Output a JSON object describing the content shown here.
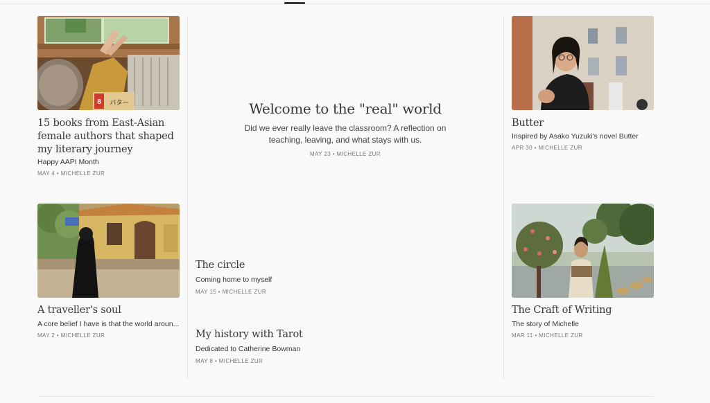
{
  "posts": {
    "left_top": {
      "title": "15 books from East-Asian female authors that shaped my literary journey",
      "subtitle": "Happy AAPI Month",
      "date": "MAY 4",
      "author": "MICHELLE ZUR"
    },
    "left_bottom": {
      "title": "A traveller's soul",
      "subtitle": "A core belief I have is that the world aroun...",
      "date": "MAY 2",
      "author": "MICHELLE ZUR"
    },
    "featured": {
      "title": "Welcome to the \"real\" world",
      "subtitle": "Did we ever really leave the classroom? A reflection on teaching, leaving, and what stays with us.",
      "date": "MAY 23",
      "author": "MICHELLE ZUR"
    },
    "middle_1": {
      "title": "The circle",
      "subtitle": "Coming home to myself",
      "date": "MAY 15",
      "author": "MICHELLE ZUR"
    },
    "middle_2": {
      "title": "My history with Tarot",
      "subtitle": "Dedicated to Catherine Bowman",
      "date": "MAY 8",
      "author": "MICHELLE ZUR"
    },
    "right_top": {
      "title": "Butter",
      "subtitle": "Inspired by Asako Yuzuki's novel Butter",
      "date": "APR 30",
      "author": "MICHELLE ZUR"
    },
    "right_bottom": {
      "title": "The Craft of Writing",
      "subtitle": "The story of Michelle",
      "date": "MAR 11",
      "author": "MICHELLE ZUR"
    }
  },
  "separator": "•",
  "image_labels": {
    "box_label": "バター",
    "box_number": "8"
  },
  "colors": {
    "text": "#363737",
    "meta": "#777777",
    "divider": "#e4e4e4",
    "background": "#f9f9f9"
  }
}
